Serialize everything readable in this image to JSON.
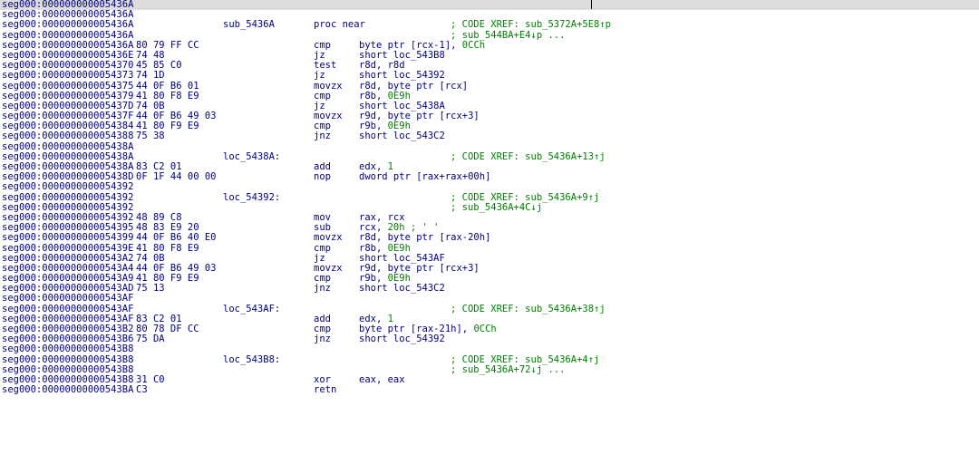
{
  "colors": {
    "text": "#000080",
    "comment": "#008000",
    "selection": "#dcdcdc",
    "background": "#ffffff"
  },
  "lines": [
    {
      "a": "seg000:000000000005436A",
      "b": "",
      "l": "",
      "m": "",
      "o": "",
      "n": "",
      "c": "",
      "sel": true
    },
    {
      "a": "seg000:000000000005436A",
      "b": "",
      "l": "",
      "m": "",
      "o": "",
      "n": "",
      "c": ""
    },
    {
      "a": "seg000:000000000005436A",
      "b": "",
      "l": "sub_5436A",
      "m": "proc near",
      "o": "",
      "n": "",
      "c": "; CODE XREF: sub_5372A+5E8↑p"
    },
    {
      "a": "seg000:000000000005436A",
      "b": "",
      "l": "",
      "m": "",
      "o": "",
      "n": "",
      "c": "; sub_544BA+E4↓p ..."
    },
    {
      "a": "seg000:000000000005436A",
      "b": "80 79 FF CC",
      "l": "",
      "m": "cmp",
      "o": "byte ptr [rcx-1], ",
      "n": "0CCh",
      "c": ""
    },
    {
      "a": "seg000:000000000005436E",
      "b": "74 48",
      "l": "",
      "m": "jz",
      "o": "short loc_543B8",
      "n": "",
      "c": ""
    },
    {
      "a": "seg000:0000000000054370",
      "b": "45 85 C0",
      "l": "",
      "m": "test",
      "o": "r8d, r8d",
      "n": "",
      "c": ""
    },
    {
      "a": "seg000:0000000000054373",
      "b": "74 1D",
      "l": "",
      "m": "jz",
      "o": "short loc_54392",
      "n": "",
      "c": ""
    },
    {
      "a": "seg000:0000000000054375",
      "b": "44 0F B6 01",
      "l": "",
      "m": "movzx",
      "o": "r8d, byte ptr [rcx]",
      "n": "",
      "c": ""
    },
    {
      "a": "seg000:0000000000054379",
      "b": "41 80 F8 E9",
      "l": "",
      "m": "cmp",
      "o": "r8b, ",
      "n": "0E9h",
      "c": ""
    },
    {
      "a": "seg000:000000000005437D",
      "b": "74 0B",
      "l": "",
      "m": "jz",
      "o": "short loc_5438A",
      "n": "",
      "c": ""
    },
    {
      "a": "seg000:000000000005437F",
      "b": "44 0F B6 49 03",
      "l": "",
      "m": "movzx",
      "o": "r9d, byte ptr [rcx+3]",
      "n": "",
      "c": ""
    },
    {
      "a": "seg000:0000000000054384",
      "b": "41 80 F9 E9",
      "l": "",
      "m": "cmp",
      "o": "r9b, ",
      "n": "0E9h",
      "c": ""
    },
    {
      "a": "seg000:0000000000054388",
      "b": "75 38",
      "l": "",
      "m": "jnz",
      "o": "short loc_543C2",
      "n": "",
      "c": ""
    },
    {
      "a": "seg000:000000000005438A",
      "b": "",
      "l": "",
      "m": "",
      "o": "",
      "n": "",
      "c": ""
    },
    {
      "a": "seg000:000000000005438A",
      "b": "",
      "l": "loc_5438A:",
      "m": "",
      "o": "",
      "n": "",
      "c": "; CODE XREF: sub_5436A+13↑j"
    },
    {
      "a": "seg000:000000000005438A",
      "b": "83 C2 01",
      "l": "",
      "m": "add",
      "o": "edx, ",
      "n": "1",
      "c": ""
    },
    {
      "a": "seg000:000000000005438D",
      "b": "0F 1F 44 00 00",
      "l": "",
      "m": "nop",
      "o": "dword ptr [rax+rax+00h]",
      "n": "",
      "c": ""
    },
    {
      "a": "seg000:0000000000054392",
      "b": "",
      "l": "",
      "m": "",
      "o": "",
      "n": "",
      "c": ""
    },
    {
      "a": "seg000:0000000000054392",
      "b": "",
      "l": "loc_54392:",
      "m": "",
      "o": "",
      "n": "",
      "c": "; CODE XREF: sub_5436A+9↑j"
    },
    {
      "a": "seg000:0000000000054392",
      "b": "",
      "l": "",
      "m": "",
      "o": "",
      "n": "",
      "c": "; sub_5436A+4C↓j"
    },
    {
      "a": "seg000:0000000000054392",
      "b": "48 89 C8",
      "l": "",
      "m": "mov",
      "o": "rax, rcx",
      "n": "",
      "c": ""
    },
    {
      "a": "seg000:0000000000054395",
      "b": "48 83 E9 20",
      "l": "",
      "m": "sub",
      "o": "rcx, ",
      "n": "20h ; ' '",
      "c": ""
    },
    {
      "a": "seg000:0000000000054399",
      "b": "44 0F B6 40 E0",
      "l": "",
      "m": "movzx",
      "o": "r8d, byte ptr [rax-20h]",
      "n": "",
      "c": ""
    },
    {
      "a": "seg000:000000000005439E",
      "b": "41 80 F8 E9",
      "l": "",
      "m": "cmp",
      "o": "r8b, ",
      "n": "0E9h",
      "c": ""
    },
    {
      "a": "seg000:00000000000543A2",
      "b": "74 0B",
      "l": "",
      "m": "jz",
      "o": "short loc_543AF",
      "n": "",
      "c": ""
    },
    {
      "a": "seg000:00000000000543A4",
      "b": "44 0F B6 49 03",
      "l": "",
      "m": "movzx",
      "o": "r9d, byte ptr [rcx+3]",
      "n": "",
      "c": ""
    },
    {
      "a": "seg000:00000000000543A9",
      "b": "41 80 F9 E9",
      "l": "",
      "m": "cmp",
      "o": "r9b, ",
      "n": "0E9h",
      "c": ""
    },
    {
      "a": "seg000:00000000000543AD",
      "b": "75 13",
      "l": "",
      "m": "jnz",
      "o": "short loc_543C2",
      "n": "",
      "c": ""
    },
    {
      "a": "seg000:00000000000543AF",
      "b": "",
      "l": "",
      "m": "",
      "o": "",
      "n": "",
      "c": ""
    },
    {
      "a": "seg000:00000000000543AF",
      "b": "",
      "l": "loc_543AF:",
      "m": "",
      "o": "",
      "n": "",
      "c": "; CODE XREF: sub_5436A+38↑j"
    },
    {
      "a": "seg000:00000000000543AF",
      "b": "83 C2 01",
      "l": "",
      "m": "add",
      "o": "edx, ",
      "n": "1",
      "c": ""
    },
    {
      "a": "seg000:00000000000543B2",
      "b": "80 78 DF CC",
      "l": "",
      "m": "cmp",
      "o": "byte ptr [rax-21h], ",
      "n": "0CCh",
      "c": ""
    },
    {
      "a": "seg000:00000000000543B6",
      "b": "75 DA",
      "l": "",
      "m": "jnz",
      "o": "short loc_54392",
      "n": "",
      "c": ""
    },
    {
      "a": "seg000:00000000000543B8",
      "b": "",
      "l": "",
      "m": "",
      "o": "",
      "n": "",
      "c": ""
    },
    {
      "a": "seg000:00000000000543B8",
      "b": "",
      "l": "loc_543B8:",
      "m": "",
      "o": "",
      "n": "",
      "c": "; CODE XREF: sub_5436A+4↑j"
    },
    {
      "a": "seg000:00000000000543B8",
      "b": "",
      "l": "",
      "m": "",
      "o": "",
      "n": "",
      "c": "; sub_5436A+72↓j ..."
    },
    {
      "a": "seg000:00000000000543B8",
      "b": "31 C0",
      "l": "",
      "m": "xor",
      "o": "eax, eax",
      "n": "",
      "c": ""
    },
    {
      "a": "seg000:00000000000543BA",
      "b": "C3",
      "l": "",
      "m": "retn",
      "o": "",
      "n": "",
      "c": ""
    }
  ]
}
